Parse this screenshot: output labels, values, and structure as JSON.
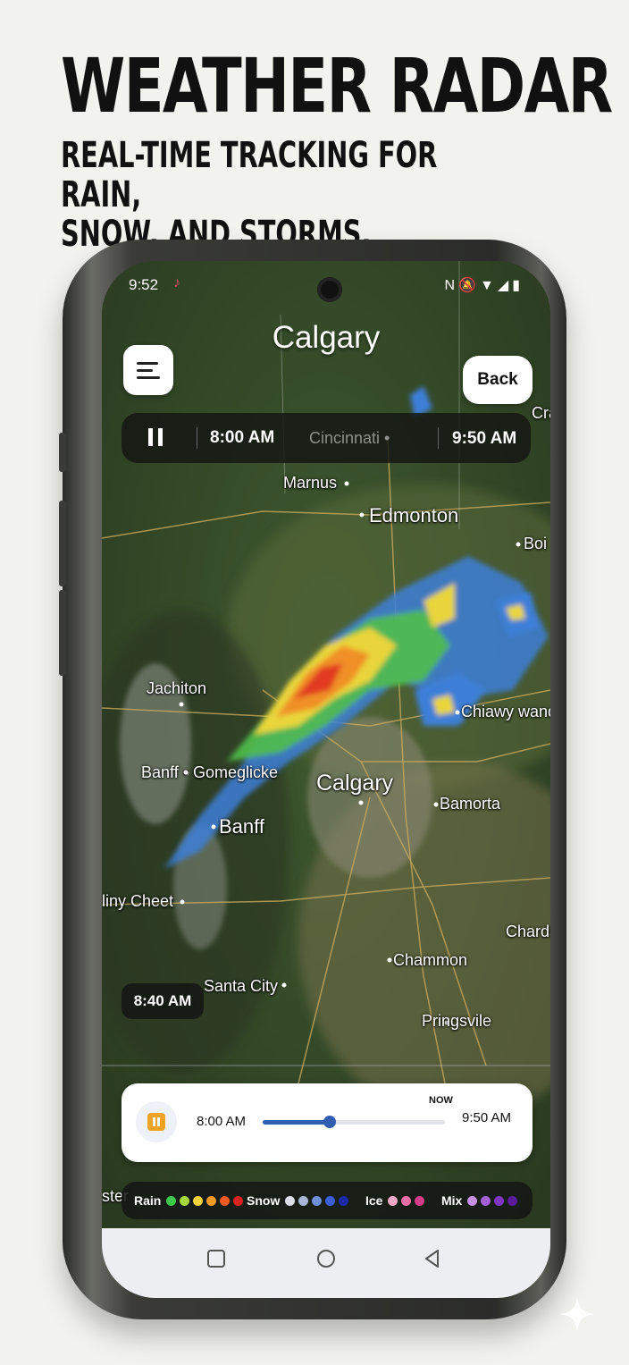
{
  "promo": {
    "headline": "WEATHER RADAR",
    "subline": "REAL-TIME TRACKING FOR RAIN,\nSNOW, AND STORMS."
  },
  "status_bar": {
    "time": "9:52",
    "notification_icon": "tiktok-icon",
    "system_icons": [
      "nfc-icon",
      "mute-icon",
      "wifi-icon",
      "signal-icon",
      "battery-icon"
    ]
  },
  "header": {
    "title": "Calgary",
    "menu_icon": "menu-icon",
    "back_label": "Back"
  },
  "top_bar": {
    "start_time": "8:00 AM",
    "location": "Cincinnati",
    "end_time": "9:50 AM"
  },
  "map": {
    "labels": [
      {
        "id": "cra",
        "text": "Cra"
      },
      {
        "id": "marnus",
        "text": "Marnus"
      },
      {
        "id": "edmonton",
        "text": "Edmonton"
      },
      {
        "id": "boi",
        "text": "Boi"
      },
      {
        "id": "jachiton",
        "text": "Jachiton"
      },
      {
        "id": "chiawy",
        "text": "Chiawy wand"
      },
      {
        "id": "banff-gome",
        "text": "Banff • Gomeglicke"
      },
      {
        "id": "calgary",
        "text": "Calgary"
      },
      {
        "id": "bamorta",
        "text": "Bamorta"
      },
      {
        "id": "banff",
        "text": "Banff"
      },
      {
        "id": "liny",
        "text": "liny Cheet"
      },
      {
        "id": "chards",
        "text": "Chards"
      },
      {
        "id": "chammon",
        "text": "Chammon"
      },
      {
        "id": "santa",
        "text": "Santa City"
      },
      {
        "id": "pringsvile",
        "text": "Pringsvile"
      },
      {
        "id": "ster",
        "text": "ster"
      }
    ],
    "time_chip": "8:40 AM"
  },
  "timeline": {
    "start_label": "8:00 AM",
    "now_label": "NOW",
    "end_label": "9:50 AM",
    "progress_fraction": 0.37,
    "play_icon": "pause-icon"
  },
  "legend": {
    "groups": [
      {
        "label": "Rain",
        "colors": [
          "#3fc94a",
          "#a7d83c",
          "#f3d23a",
          "#f39c25",
          "#ef5a23",
          "#d8231f"
        ]
      },
      {
        "label": "Snow",
        "colors": [
          "#d9dee8",
          "#a9b6d6",
          "#6f8fd8",
          "#3b5fd4",
          "#1a2aa8"
        ]
      },
      {
        "label": "Ice",
        "colors": [
          "#f1a8c8",
          "#ea6fa8",
          "#d43c8c"
        ]
      },
      {
        "label": "Mix",
        "colors": [
          "#c78ee2",
          "#a45fd2",
          "#8035c0",
          "#5d1a9a"
        ]
      }
    ]
  },
  "nav_bar": {
    "icons": [
      "recents-icon",
      "home-icon",
      "back-icon"
    ]
  }
}
